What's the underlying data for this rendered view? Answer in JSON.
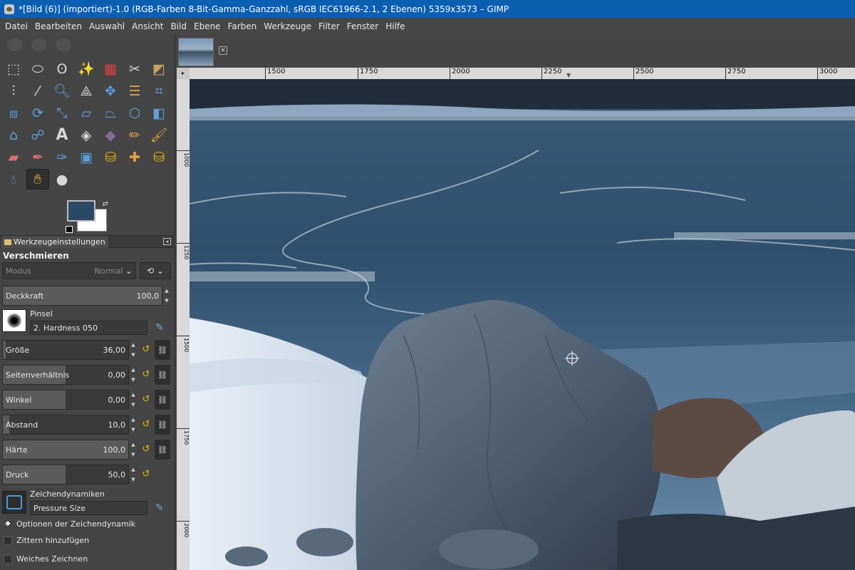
{
  "window": {
    "title": "*[Bild (6)] (importiert)-1.0 (RGB-Farben 8-Bit-Gamma-Ganzzahl, sRGB IEC61966-2.1, 2 Ebenen) 5359x3573 – GIMP"
  },
  "menu": [
    "Datei",
    "Bearbeiten",
    "Auswahl",
    "Ansicht",
    "Bild",
    "Ebene",
    "Farben",
    "Werkzeuge",
    "Filter",
    "Fenster",
    "Hilfe"
  ],
  "colors": {
    "foreground": "#2b4966",
    "background": "#ffffff",
    "accent": "#e2b400"
  },
  "tools": [
    "rect-select-icon",
    "ellipse-select-icon",
    "free-select-icon",
    "fuzzy-select-icon",
    "by-color-select-icon",
    "scissors-select-icon",
    "foreground-select-icon",
    "paths-icon",
    "color-picker-icon",
    "zoom-icon",
    "measure-icon",
    "move-icon",
    "align-icon",
    "crop-icon",
    "unified-transform-icon",
    "rotate-icon",
    "scale-icon",
    "shear-icon",
    "perspective-icon",
    "3d-transform-icon",
    "flip-icon",
    "cage-transform-icon",
    "warp-transform-icon",
    "text-icon",
    "bucket-fill-icon",
    "gradient-icon",
    "pencil-icon",
    "paintbrush-icon",
    "eraser-icon",
    "airbrush-icon",
    "ink-icon",
    "mypaint-brush-icon",
    "clone-icon",
    "heal-icon",
    "perspective-clone-icon",
    "blur-sharpen-icon",
    "smudge-icon",
    "dodge-burn-icon"
  ],
  "tool_options": {
    "tab_label": "Werkzeugeinstellungen",
    "tool_name": "Verschmieren",
    "mode_label": "Modus",
    "mode_value": "Normal",
    "opacity": {
      "label": "Deckkraft",
      "value": "100,0",
      "fraction": 1.0
    },
    "brush": {
      "label": "Pinsel",
      "name": "2. Hardness 050"
    },
    "sliders": [
      {
        "label": "Größe",
        "value": "36,00",
        "fraction": 0.02
      },
      {
        "label": "Seitenverhältnis",
        "value": "0,00",
        "fraction": 0.5
      },
      {
        "label": "Winkel",
        "value": "0,00",
        "fraction": 0.5
      },
      {
        "label": "Abstand",
        "value": "10,0",
        "fraction": 0.05
      },
      {
        "label": "Härte",
        "value": "100,0",
        "fraction": 1.0
      },
      {
        "label": "Druck",
        "value": "50,0",
        "fraction": 0.5
      }
    ],
    "dynamics": {
      "label": "Zeichendynamiken",
      "name": "Pressure Size"
    },
    "checkboxes": [
      {
        "label": "Optionen der Zeichendynamik",
        "expander": true
      },
      {
        "label": "Zittern hinzufügen",
        "checked": false
      },
      {
        "label": "Weiches Zeichnen",
        "checked": false
      }
    ]
  },
  "ruler": {
    "ticks": [
      "1500",
      "1750",
      "2000",
      "2250",
      "2500",
      "2750",
      "3000"
    ]
  },
  "vruler": {
    "ticks": [
      "1000",
      "1250",
      "1500",
      "1750",
      "2000"
    ]
  }
}
